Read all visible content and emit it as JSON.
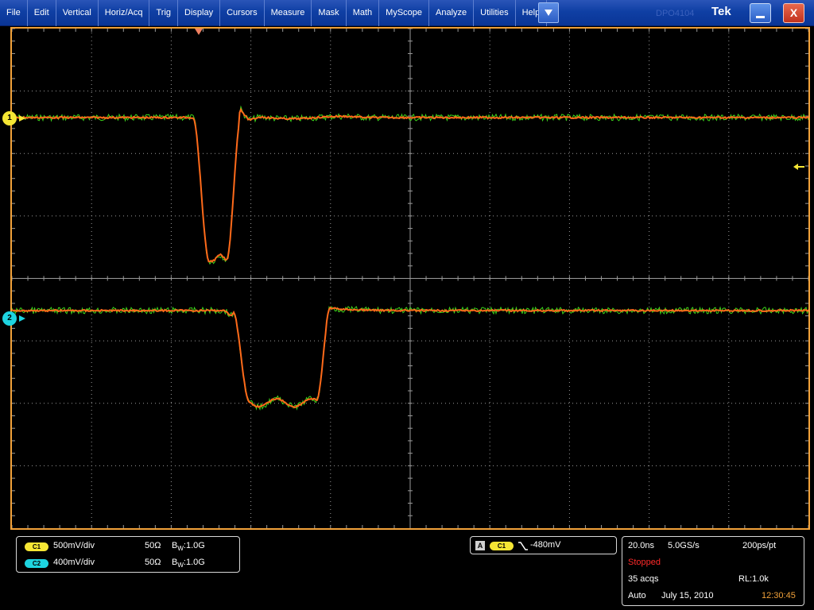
{
  "menubar": {
    "items": [
      "File",
      "Edit",
      "Vertical",
      "Horiz/Acq",
      "Trig",
      "Display",
      "Cursors",
      "Measure",
      "Mask",
      "Math",
      "MyScope",
      "Analyze",
      "Utilities",
      "Help"
    ],
    "brand_faint": "DPO4104",
    "logo": "Tek",
    "close_label": "X"
  },
  "channels": [
    {
      "id": "1",
      "pill": "C1",
      "scale": "500mV/div",
      "impedance": "50Ω",
      "bw_prefix": "B",
      "bw_sub": "W",
      "bw_value": ":1.0G",
      "color": "#f5e634"
    },
    {
      "id": "2",
      "pill": "C2",
      "scale": "400mV/div",
      "impedance": "50Ω",
      "bw_prefix": "B",
      "bw_sub": "W",
      "bw_value": ":1.0G",
      "color": "#1ed4e0"
    }
  ],
  "trigger": {
    "mode_letter": "A",
    "source": "C1",
    "slope_icon": "falling-edge-icon",
    "level": "-480mV"
  },
  "acquisition": {
    "time_per_div": "20.0ns",
    "sample_rate": "5.0GS/s",
    "resolution": "200ps/pt",
    "status": "Stopped",
    "acqs": "35 acqs",
    "record_length": "RL:1.0k",
    "trigger_mode": "Auto",
    "date": "July 15, 2010",
    "time": "12:30:45"
  },
  "colors": {
    "trace": "#ff6a1a",
    "trace_noise": "#3cd61a",
    "graticule": "#9a9a9a",
    "frame": "#f2a23a",
    "stopped": "#ff2a2a",
    "clock": "#f2a23a"
  }
}
